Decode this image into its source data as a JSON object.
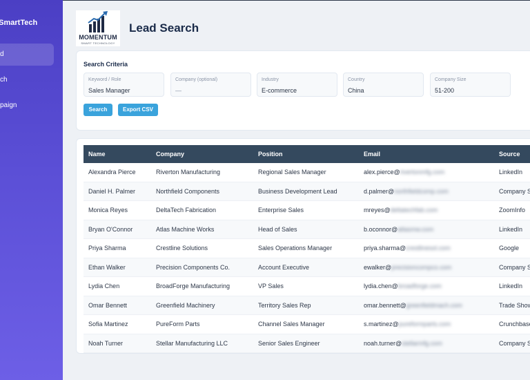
{
  "sidebar": {
    "brand": "tumSmartTech",
    "items": [
      {
        "label": "d",
        "active": true
      },
      {
        "label": "ch",
        "active": false
      },
      {
        "label": "paign",
        "active": false
      }
    ]
  },
  "logo": {
    "name": "MOMENTUM",
    "tagline": "SMART TECHNOLOGY"
  },
  "page_title": "Lead Search",
  "criteria": {
    "title": "Search Criteria",
    "fields": [
      {
        "label": "Keyword / Role",
        "value": "Sales Manager"
      },
      {
        "label": "Company (optional)",
        "value": "—"
      },
      {
        "label": "Industry",
        "value": "E-commerce"
      },
      {
        "label": "Country",
        "value": "China"
      },
      {
        "label": "Company Size",
        "value": "51-200"
      }
    ],
    "search_button": "Search",
    "export_button": "Export CSV"
  },
  "table": {
    "columns": [
      "Name",
      "Company",
      "Position",
      "Email",
      "Source"
    ],
    "rows": [
      {
        "name": "Alexandra Pierce",
        "company": "Riverton Manufacturing",
        "position": "Regional Sales Manager",
        "email_user": "alex.pierce@",
        "email_domain": "rivertonmfg.com",
        "source": "LinkedIn"
      },
      {
        "name": "Daniel H. Palmer",
        "company": "Northfield Components",
        "position": "Business Development Lead",
        "email_user": "d.palmer@",
        "email_domain": "northfieldcomp.com",
        "source": "Company S"
      },
      {
        "name": "Monica Reyes",
        "company": "DeltaTech Fabrication",
        "position": "Enterprise Sales",
        "email_user": "mreyes@",
        "email_domain": "deltatechfab.com",
        "source": "ZoomInfo"
      },
      {
        "name": "Bryan O'Connor",
        "company": "Atlas Machine Works",
        "position": "Head of Sales",
        "email_user": "b.oconnor@",
        "email_domain": "atlasmw.com",
        "source": "LinkedIn"
      },
      {
        "name": "Priya Sharma",
        "company": "Crestline Solutions",
        "position": "Sales Operations Manager",
        "email_user": "priya.sharma@",
        "email_domain": "crestlinesol.com",
        "source": "Google"
      },
      {
        "name": "Ethan Walker",
        "company": "Precision Components Co.",
        "position": "Account Executive",
        "email_user": "ewalker@",
        "email_domain": "precisioncompco.com",
        "source": "Company S"
      },
      {
        "name": "Lydia Chen",
        "company": "BroadForge Manufacturing",
        "position": "VP Sales",
        "email_user": "lydia.chen@",
        "email_domain": "broadforge.com",
        "source": "LinkedIn"
      },
      {
        "name": "Omar Bennett",
        "company": "Greenfield Machinery",
        "position": "Territory Sales Rep",
        "email_user": "omar.bennett@",
        "email_domain": "greenfieldmach.com",
        "source": "Trade Show"
      },
      {
        "name": "Sofia Martinez",
        "company": "PureForm Parts",
        "position": "Channel Sales Manager",
        "email_user": "s.martinez@",
        "email_domain": "pureformparts.com",
        "source": "Crunchbase"
      },
      {
        "name": "Noah Turner",
        "company": "Stellar Manufacturing LLC",
        "position": "Senior Sales Engineer",
        "email_user": "noah.turner@",
        "email_domain": "stellarmfg.com",
        "source": "Company S"
      }
    ]
  }
}
